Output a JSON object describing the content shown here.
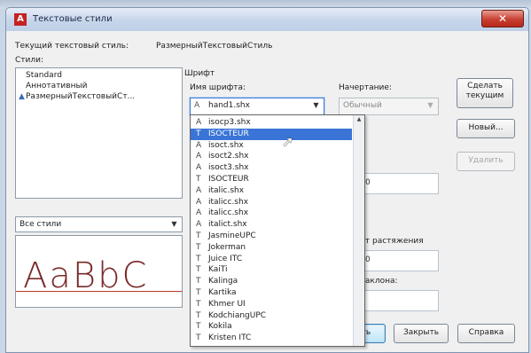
{
  "window": {
    "title": "Текстовые стили",
    "close_glyph": "✕"
  },
  "current_style_label": "Текущий текстовый стиль:",
  "current_style_value": "РазмерныйТекстовыйСтиль",
  "styles_label": "Стили:",
  "styles": [
    "Standard",
    "Аннотативный",
    "РазмерныйТекстовыйСт..."
  ],
  "filter": {
    "value": "Все стили"
  },
  "preview_text": "AaBbC",
  "font": {
    "group_label": "Шрифт",
    "name_label": "Имя шрифта:",
    "selected": "hand1.shx",
    "style_label": "Начертание:",
    "style_value": "Обычный"
  },
  "height": {
    "label": "та",
    "value": "0"
  },
  "width_factor": {
    "label": "нт растяжения",
    "value": "0"
  },
  "oblique": {
    "label": "наклона:"
  },
  "buttons": {
    "set_current": "Сделать текущим",
    "new": "Новый...",
    "delete": "Удалить",
    "apply": "ить",
    "close": "Закрыть",
    "help": "Справка"
  },
  "font_list": [
    {
      "name": "isocp3.shx",
      "icon": "shx-font-icon",
      "glyph": "A"
    },
    {
      "name": "ISOCTEUR",
      "icon": "truetype-icon",
      "glyph": "T",
      "selected": true
    },
    {
      "name": "isoct.shx",
      "icon": "shx-font-icon",
      "glyph": "A"
    },
    {
      "name": "isoct2.shx",
      "icon": "shx-font-icon",
      "glyph": "A"
    },
    {
      "name": "isoct3.shx",
      "icon": "shx-font-icon",
      "glyph": "A"
    },
    {
      "name": "ISOCTEUR",
      "icon": "truetype-icon",
      "glyph": "T"
    },
    {
      "name": "italic.shx",
      "icon": "shx-font-icon",
      "glyph": "A"
    },
    {
      "name": "italicc.shx",
      "icon": "shx-font-icon",
      "glyph": "A"
    },
    {
      "name": "italicc.shx",
      "icon": "shx-font-icon",
      "glyph": "A"
    },
    {
      "name": "italict.shx",
      "icon": "shx-font-icon",
      "glyph": "A"
    },
    {
      "name": "JasmineUPC",
      "icon": "truetype-icon",
      "glyph": "T"
    },
    {
      "name": "Jokerman",
      "icon": "truetype-icon",
      "glyph": "T"
    },
    {
      "name": "Juice ITC",
      "icon": "truetype-icon",
      "glyph": "T"
    },
    {
      "name": "KaiTi",
      "icon": "truetype-icon",
      "glyph": "T"
    },
    {
      "name": "Kalinga",
      "icon": "truetype-icon",
      "glyph": "T"
    },
    {
      "name": "Kartika",
      "icon": "truetype-icon",
      "glyph": "T"
    },
    {
      "name": "Khmer UI",
      "icon": "truetype-icon",
      "glyph": "T"
    },
    {
      "name": "KodchiangUPC",
      "icon": "truetype-icon",
      "glyph": "T"
    },
    {
      "name": "Kokila",
      "icon": "truetype-icon",
      "glyph": "T"
    },
    {
      "name": "Kristen ITC",
      "icon": "truetype-icon",
      "glyph": "T"
    }
  ],
  "colors": {
    "selection": "#3a74d6",
    "title_icon": "#c52222"
  }
}
